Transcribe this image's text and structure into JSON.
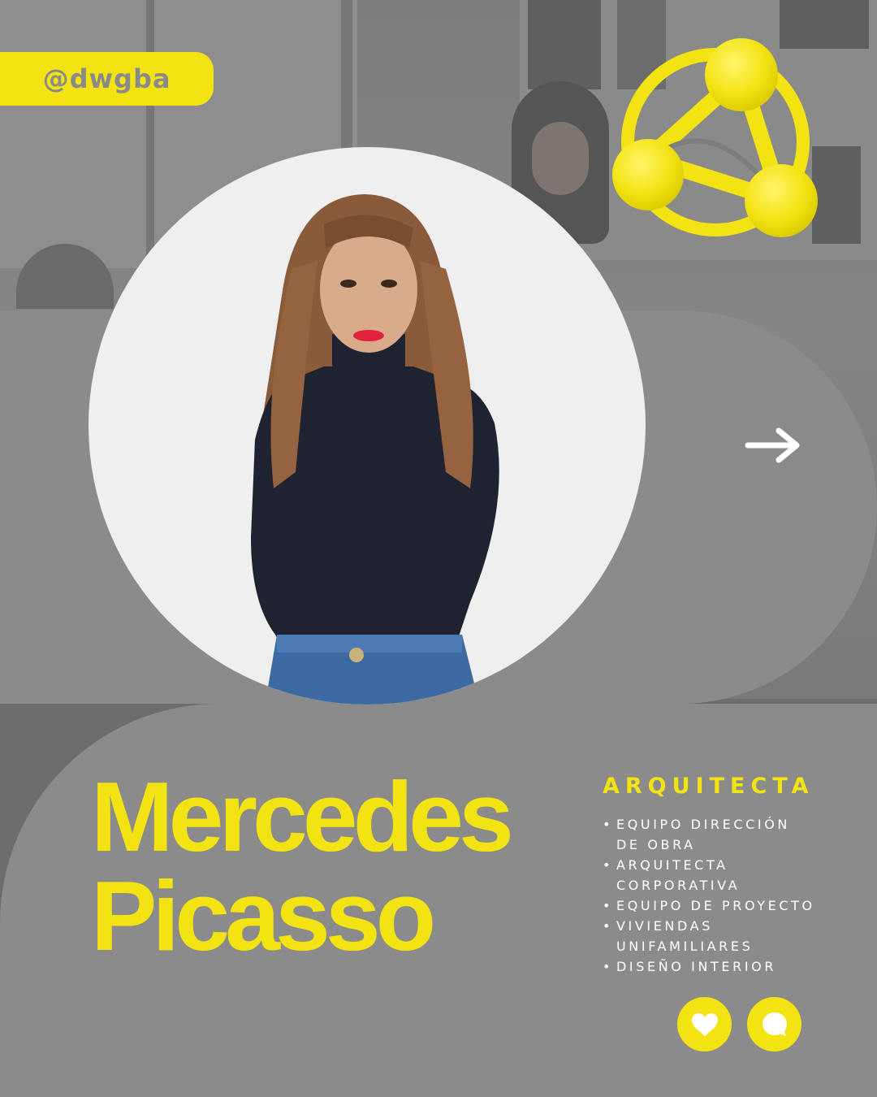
{
  "handle": "@dwgba",
  "name": {
    "first": "Mercedes",
    "last": "Picasso"
  },
  "role": "ARQUITECTA",
  "skills": [
    {
      "lines": [
        "EQUIPO DIRECCIÓN",
        "DE OBRA"
      ]
    },
    {
      "lines": [
        "ARQUITECTA",
        "CORPORATIVA"
      ]
    },
    {
      "lines": [
        "EQUIPO DE PROYECTO"
      ]
    },
    {
      "lines": [
        "VIVIENDAS",
        "UNIFAMILIARES"
      ]
    },
    {
      "lines": [
        "DISEÑO INTERIOR"
      ]
    }
  ],
  "icons": {
    "logo": "yellow-molecule-logo-icon",
    "next": "arrow-right-icon",
    "like": "heart-icon",
    "comment": "speech-bubble-icon"
  },
  "colors": {
    "accent": "#f4e313",
    "panel": "#8b8b8b",
    "text": "#ffffff"
  }
}
